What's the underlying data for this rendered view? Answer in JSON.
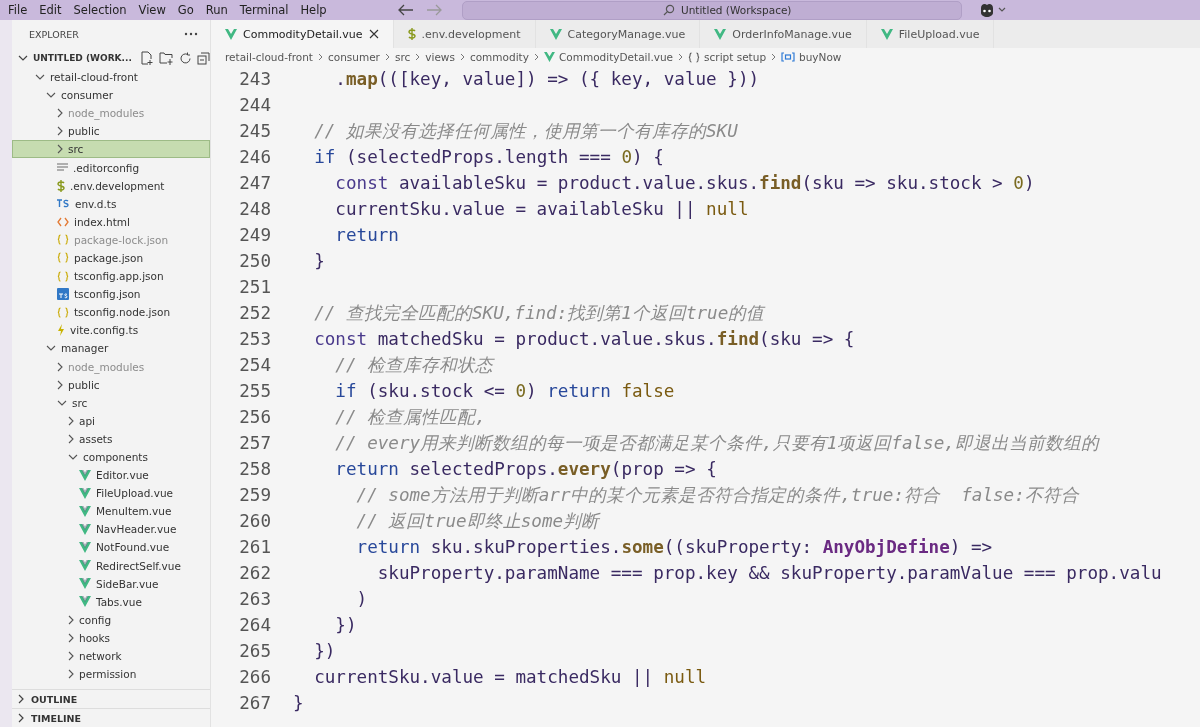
{
  "menu": [
    "File",
    "Edit",
    "Selection",
    "View",
    "Go",
    "Run",
    "Terminal",
    "Help"
  ],
  "command_center": {
    "title": "Untitled (Workspace)"
  },
  "explorer": {
    "title": "EXPLORER",
    "workspace": "UNTITLED (WORK...",
    "tree": [
      {
        "name": "retail-cloud-front",
        "kind": "folder",
        "expanded": true,
        "selected": false,
        "dimmed": false,
        "children": [
          {
            "name": "consumer",
            "kind": "folder",
            "expanded": true,
            "selected": false,
            "dimmed": false,
            "children": [
              {
                "name": "node_modules",
                "kind": "folder",
                "expanded": false,
                "selected": false,
                "dimmed": true
              },
              {
                "name": "public",
                "kind": "folder",
                "expanded": false,
                "selected": false,
                "dimmed": false
              },
              {
                "name": "src",
                "kind": "folder",
                "expanded": false,
                "selected": true,
                "dimmed": false
              },
              {
                "name": ".editorconfig",
                "kind": "config",
                "selected": false,
                "dimmed": false
              },
              {
                "name": ".env.development",
                "kind": "env",
                "selected": false,
                "dimmed": false
              },
              {
                "name": "env.d.ts",
                "kind": "ts",
                "selected": false,
                "dimmed": false
              },
              {
                "name": "index.html",
                "kind": "html",
                "selected": false,
                "dimmed": false
              },
              {
                "name": "package-lock.json",
                "kind": "json",
                "selected": false,
                "dimmed": true
              },
              {
                "name": "package.json",
                "kind": "json",
                "selected": false,
                "dimmed": false
              },
              {
                "name": "tsconfig.app.json",
                "kind": "json",
                "selected": false,
                "dimmed": false
              },
              {
                "name": "tsconfig.json",
                "kind": "tsconfig",
                "selected": false,
                "dimmed": false
              },
              {
                "name": "tsconfig.node.json",
                "kind": "json",
                "selected": false,
                "dimmed": false
              },
              {
                "name": "vite.config.ts",
                "kind": "vite",
                "selected": false,
                "dimmed": false
              }
            ]
          },
          {
            "name": "manager",
            "kind": "folder",
            "expanded": true,
            "selected": false,
            "dimmed": false,
            "children": [
              {
                "name": "node_modules",
                "kind": "folder",
                "expanded": false,
                "selected": false,
                "dimmed": true
              },
              {
                "name": "public",
                "kind": "folder",
                "expanded": false,
                "selected": false,
                "dimmed": false
              },
              {
                "name": "src",
                "kind": "folder",
                "expanded": true,
                "selected": false,
                "dimmed": false,
                "children": [
                  {
                    "name": "api",
                    "kind": "folder",
                    "expanded": false,
                    "selected": false,
                    "dimmed": false
                  },
                  {
                    "name": "assets",
                    "kind": "folder",
                    "expanded": false,
                    "selected": false,
                    "dimmed": false
                  },
                  {
                    "name": "components",
                    "kind": "folder",
                    "expanded": true,
                    "selected": false,
                    "dimmed": false,
                    "children": [
                      {
                        "name": "Editor.vue",
                        "kind": "vue",
                        "selected": false,
                        "dimmed": false
                      },
                      {
                        "name": "FileUpload.vue",
                        "kind": "vue",
                        "selected": false,
                        "dimmed": false
                      },
                      {
                        "name": "MenuItem.vue",
                        "kind": "vue",
                        "selected": false,
                        "dimmed": false
                      },
                      {
                        "name": "NavHeader.vue",
                        "kind": "vue",
                        "selected": false,
                        "dimmed": false
                      },
                      {
                        "name": "NotFound.vue",
                        "kind": "vue",
                        "selected": false,
                        "dimmed": false
                      },
                      {
                        "name": "RedirectSelf.vue",
                        "kind": "vue",
                        "selected": false,
                        "dimmed": false
                      },
                      {
                        "name": "SideBar.vue",
                        "kind": "vue",
                        "selected": false,
                        "dimmed": false
                      },
                      {
                        "name": "Tabs.vue",
                        "kind": "vue",
                        "selected": false,
                        "dimmed": false
                      }
                    ]
                  },
                  {
                    "name": "config",
                    "kind": "folder",
                    "expanded": false,
                    "selected": false,
                    "dimmed": false
                  },
                  {
                    "name": "hooks",
                    "kind": "folder",
                    "expanded": false,
                    "selected": false,
                    "dimmed": false
                  },
                  {
                    "name": "network",
                    "kind": "folder",
                    "expanded": false,
                    "selected": false,
                    "dimmed": false
                  },
                  {
                    "name": "permission",
                    "kind": "folder",
                    "expanded": false,
                    "selected": false,
                    "dimmed": false
                  }
                ]
              }
            ]
          }
        ]
      }
    ]
  },
  "panels": [
    {
      "label": "OUTLINE",
      "expanded": false
    },
    {
      "label": "TIMELINE",
      "expanded": false
    }
  ],
  "tabs": [
    {
      "label": "CommodityDetail.vue",
      "kind": "vue",
      "selected": true
    },
    {
      "label": ".env.development",
      "kind": "env",
      "selected": false
    },
    {
      "label": "CategoryManage.vue",
      "kind": "vue",
      "selected": false
    },
    {
      "label": "OrderInfoManage.vue",
      "kind": "vue",
      "selected": false
    },
    {
      "label": "FileUpload.vue",
      "kind": "vue",
      "selected": false
    }
  ],
  "breadcrumb": [
    {
      "label": "retail-cloud-front",
      "kind": "text"
    },
    {
      "label": "consumer",
      "kind": "text"
    },
    {
      "label": "src",
      "kind": "text"
    },
    {
      "label": "views",
      "kind": "text"
    },
    {
      "label": "commodity",
      "kind": "text"
    },
    {
      "label": "CommodityDetail.vue",
      "kind": "vue"
    },
    {
      "label": "script setup",
      "kind": "braces"
    },
    {
      "label": "buyNow",
      "kind": "variable"
    }
  ],
  "code": [
    {
      "n": "243",
      "tokens": [
        {
          "t": "    .",
          "kind": "var"
        },
        {
          "t": "map",
          "kind": "fn"
        },
        {
          "t": "(([key, value]) => ({ key, value }))",
          "kind": "var"
        }
      ]
    },
    {
      "n": "244"
    },
    {
      "n": "245",
      "tokens": [
        {
          "t": "  // 如果没有选择任何属性，使用第一个有库存的SKU",
          "kind": "cmt"
        }
      ]
    },
    {
      "n": "246",
      "tokens": [
        {
          "t": "  if",
          "kind": "kw"
        },
        {
          "t": " (selectedProps.length === ",
          "kind": "var"
        },
        {
          "t": "0",
          "kind": "num"
        },
        {
          "t": ") {",
          "kind": "var"
        }
      ]
    },
    {
      "n": "247",
      "tokens": [
        {
          "t": "    const",
          "kind": "decl"
        },
        {
          "t": " availableSku = product.value.skus.",
          "kind": "var"
        },
        {
          "t": "find",
          "kind": "fn"
        },
        {
          "t": "(sku => sku.stock > ",
          "kind": "var"
        },
        {
          "t": "0",
          "kind": "num"
        },
        {
          "t": ")",
          "kind": "var"
        }
      ]
    },
    {
      "n": "248",
      "tokens": [
        {
          "t": "    currentSku.value = availableSku || ",
          "kind": "var"
        },
        {
          "t": "null",
          "kind": "lit"
        }
      ]
    },
    {
      "n": "249",
      "tokens": [
        {
          "t": "    return",
          "kind": "kw"
        }
      ]
    },
    {
      "n": "250",
      "tokens": [
        {
          "t": "  }",
          "kind": "var"
        }
      ]
    },
    {
      "n": "251"
    },
    {
      "n": "252",
      "tokens": [
        {
          "t": "  // 查找完全匹配的SKU,find:找到第1个返回true的值",
          "kind": "cmt"
        }
      ]
    },
    {
      "n": "253",
      "tokens": [
        {
          "t": "  const",
          "kind": "decl"
        },
        {
          "t": " matchedSku = product.value.skus.",
          "kind": "var"
        },
        {
          "t": "find",
          "kind": "fn"
        },
        {
          "t": "(sku => {",
          "kind": "var"
        }
      ]
    },
    {
      "n": "254",
      "tokens": [
        {
          "t": "    // 检查库存和状态",
          "kind": "cmt"
        }
      ]
    },
    {
      "n": "255",
      "tokens": [
        {
          "t": "    if",
          "kind": "kw"
        },
        {
          "t": " (sku.stock <= ",
          "kind": "var"
        },
        {
          "t": "0",
          "kind": "num"
        },
        {
          "t": ") ",
          "kind": "var"
        },
        {
          "t": "return",
          "kind": "kw"
        },
        {
          "t": " false",
          "kind": "lit"
        }
      ]
    },
    {
      "n": "256",
      "tokens": [
        {
          "t": "    // 检查属性匹配,",
          "kind": "cmt"
        }
      ]
    },
    {
      "n": "257",
      "tokens": [
        {
          "t": "    // every用来判断数组的每一项是否都满足某个条件,只要有1项返回false,即退出当前数组的",
          "kind": "cmt"
        }
      ]
    },
    {
      "n": "258",
      "tokens": [
        {
          "t": "    return",
          "kind": "kw"
        },
        {
          "t": " selectedProps.",
          "kind": "var"
        },
        {
          "t": "every",
          "kind": "fn"
        },
        {
          "t": "(prop => {",
          "kind": "var"
        }
      ]
    },
    {
      "n": "259",
      "tokens": [
        {
          "t": "      // some方法用于判断arr中的某个元素是否符合指定的条件,true:符合  false:不符合",
          "kind": "cmt"
        }
      ]
    },
    {
      "n": "260",
      "tokens": [
        {
          "t": "      // 返回true即终止some判断",
          "kind": "cmt"
        }
      ]
    },
    {
      "n": "261",
      "tokens": [
        {
          "t": "      return",
          "kind": "kw"
        },
        {
          "t": " sku.skuProperties.",
          "kind": "var"
        },
        {
          "t": "some",
          "kind": "fn"
        },
        {
          "t": "((skuProperty: ",
          "kind": "var"
        },
        {
          "t": "AnyObjDefine",
          "kind": "type"
        },
        {
          "t": ") =>",
          "kind": "var"
        }
      ]
    },
    {
      "n": "262",
      "tokens": [
        {
          "t": "        skuProperty.paramName === prop.key && skuProperty.paramValue === prop.valu",
          "kind": "var"
        }
      ]
    },
    {
      "n": "263",
      "tokens": [
        {
          "t": "      )",
          "kind": "var"
        }
      ]
    },
    {
      "n": "264",
      "tokens": [
        {
          "t": "    })",
          "kind": "var"
        }
      ]
    },
    {
      "n": "265",
      "tokens": [
        {
          "t": "  })",
          "kind": "var"
        }
      ]
    },
    {
      "n": "266",
      "tokens": [
        {
          "t": "  currentSku.value = matchedSku || ",
          "kind": "var"
        },
        {
          "t": "null",
          "kind": "lit"
        }
      ]
    },
    {
      "n": "267",
      "tokens": [
        {
          "t": "}",
          "kind": "var"
        }
      ]
    }
  ]
}
